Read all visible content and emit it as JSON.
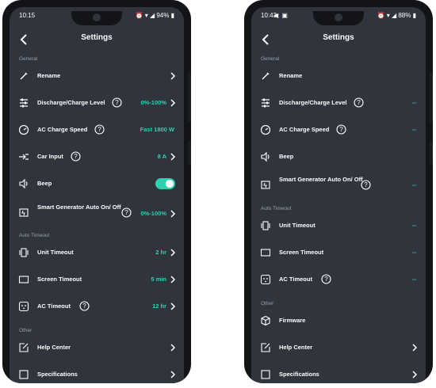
{
  "colors": {
    "accent": "#2ed1b0",
    "background": "#2f343d",
    "text": "#ffffff",
    "section": "#9aa0aa"
  },
  "left": {
    "status": {
      "time": "10:15",
      "battery": "94%"
    },
    "title": "Settings",
    "sections": {
      "general": "General",
      "auto_timeout": "Auto Timeout",
      "other": "Other"
    },
    "rows": {
      "rename": {
        "label": "Rename"
      },
      "discharge": {
        "label": "Discharge/Charge Level",
        "value": "0%-100%"
      },
      "ac_speed": {
        "label": "AC Charge Speed",
        "value": "Fast 1800 W"
      },
      "car_input": {
        "label": "Car Input",
        "value": "8 A"
      },
      "beep": {
        "label": "Beep",
        "toggle_on": true
      },
      "smart_gen": {
        "label": "Smart Generator Auto On/ Off",
        "value": "0%-100%"
      },
      "unit_timeout": {
        "label": "Unit Timeout",
        "value": "2 hr"
      },
      "screen_timeout": {
        "label": "Screen Timeout",
        "value": "5 min"
      },
      "ac_timeout": {
        "label": "AC Timeout",
        "value": "12 hr"
      },
      "help_center": {
        "label": "Help Center"
      },
      "specifications": {
        "label": "Specifications"
      }
    }
  },
  "right": {
    "status": {
      "time": "10:43",
      "battery": "88%"
    },
    "title": "Settings",
    "sections": {
      "general": "General",
      "auto_timeout": "Auto Timeout",
      "other": "Other"
    },
    "rows": {
      "rename": {
        "label": "Rename"
      },
      "discharge": {
        "label": "Discharge/Charge Level",
        "value": "--"
      },
      "ac_speed": {
        "label": "AC Charge Speed",
        "value": "--"
      },
      "beep": {
        "label": "Beep"
      },
      "smart_gen": {
        "label": "Smart Generator Auto On/ Off",
        "value": "--"
      },
      "unit_timeout": {
        "label": "Unit Timeout",
        "value": "--"
      },
      "screen_timeout": {
        "label": "Screen Timeout",
        "value": "--"
      },
      "ac_timeout": {
        "label": "AC Timeout",
        "value": "--"
      },
      "firmware": {
        "label": "Firmware"
      },
      "help_center": {
        "label": "Help Center"
      },
      "specifications": {
        "label": "Specifications"
      }
    }
  }
}
